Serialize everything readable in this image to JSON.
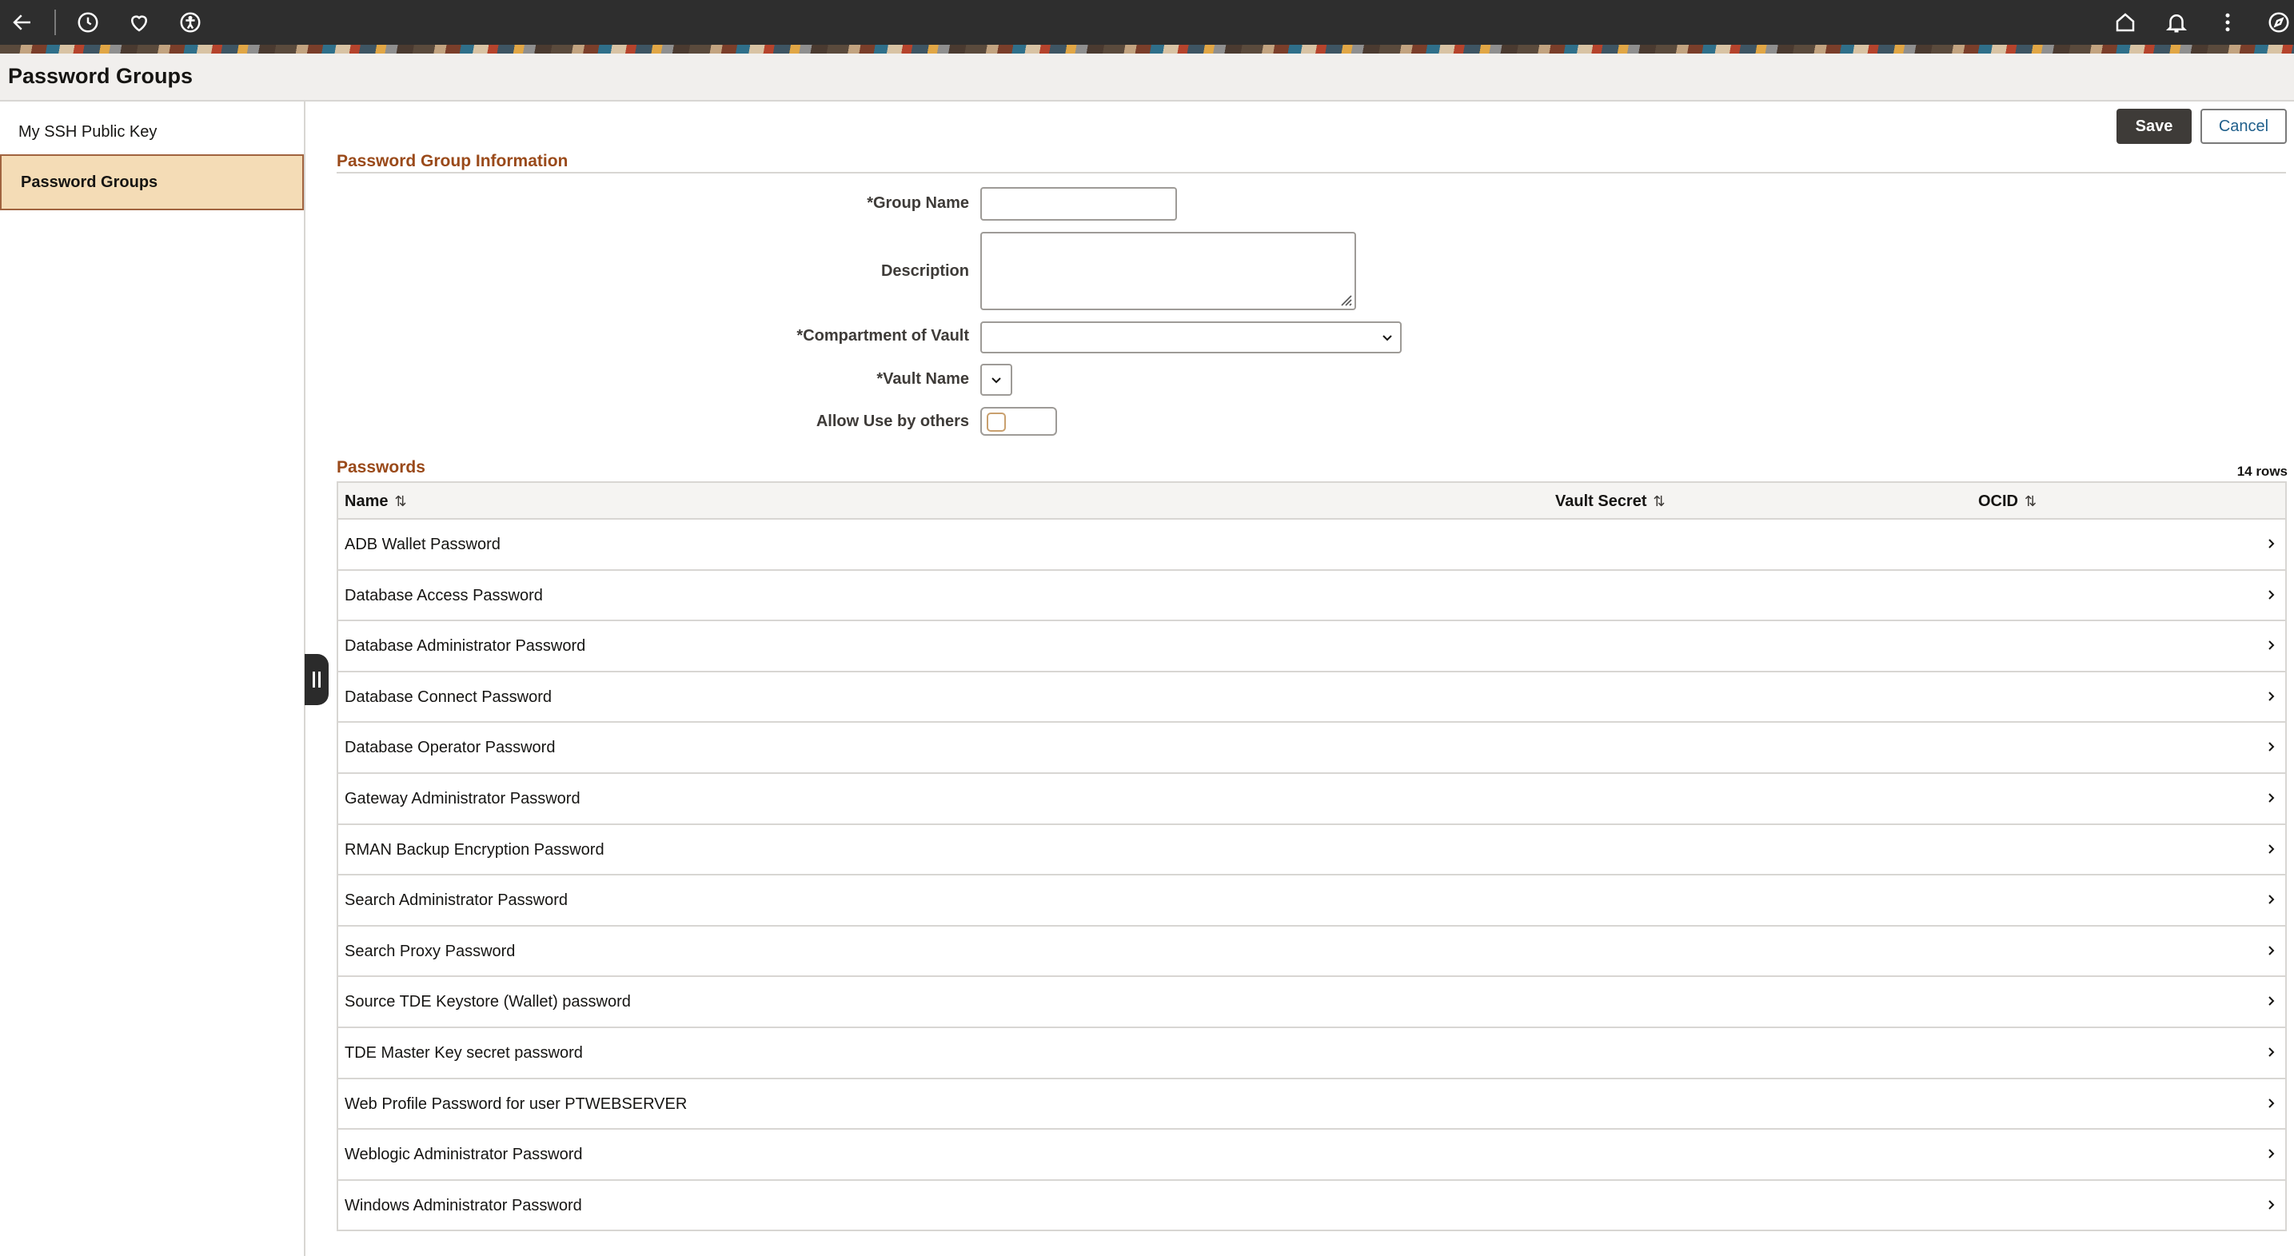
{
  "header": {
    "icons": [
      "back-arrow-icon",
      "history-icon",
      "favorites-heart-icon",
      "accessibility-icon",
      "home-icon",
      "notifications-bell-icon",
      "more-vertical-icon",
      "navigator-compass-icon"
    ]
  },
  "page": {
    "title": "Password Groups"
  },
  "sidebar": {
    "items": [
      {
        "label": "My SSH Public Key",
        "selected": false
      },
      {
        "label": "Password Groups",
        "selected": true
      }
    ]
  },
  "toolbar": {
    "save_label": "Save",
    "cancel_label": "Cancel"
  },
  "form": {
    "section_title": "Password Group Information",
    "group_name": {
      "label": "*Group Name",
      "value": ""
    },
    "description": {
      "label": "Description",
      "value": ""
    },
    "compartment": {
      "label": "*Compartment of Vault",
      "value": ""
    },
    "vault_name": {
      "label": "*Vault Name",
      "value": ""
    },
    "allow_use": {
      "label": "Allow Use by others",
      "checked": false
    }
  },
  "passwords": {
    "section_title": "Passwords",
    "row_count": "14 rows",
    "columns": [
      "Name",
      "Vault Secret",
      "OCID"
    ],
    "rows": [
      "ADB Wallet Password",
      "Database Access Password",
      "Database Administrator Password",
      "Database Connect Password",
      "Database Operator Password",
      "Gateway Administrator Password",
      "RMAN Backup Encryption Password",
      "Search Administrator Password",
      "Search Proxy Password",
      "Source TDE Keystore (Wallet) password",
      "TDE Master Key secret password",
      "Web Profile Password for user PTWEBSERVER",
      "Weblogic Administrator Password",
      "Windows Administrator Password"
    ]
  },
  "colors": {
    "accent_title": "#9a4a1a",
    "selected_bg": "#f4dcb6",
    "save_bg": "#3e3b38",
    "link": "#1f5f8b"
  }
}
